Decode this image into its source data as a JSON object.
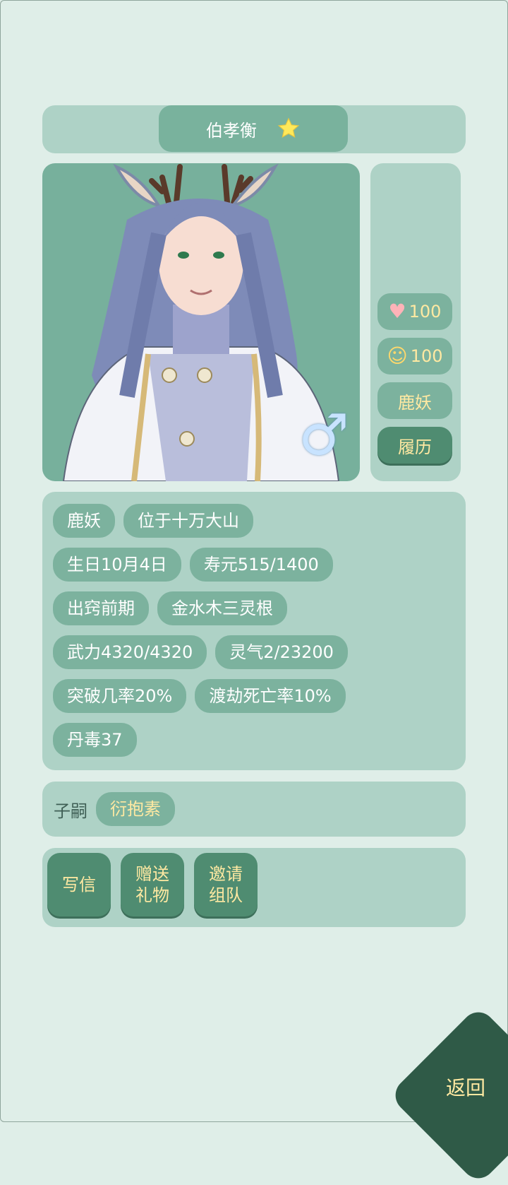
{
  "character": {
    "name": "伯孝衡",
    "gender_symbol": "♂"
  },
  "side": {
    "affection_value": "100",
    "mood_value": "100",
    "race_button": "鹿妖",
    "resume_button": "履历"
  },
  "info": {
    "tags": [
      "鹿妖",
      "位于十万大山",
      "生日10月4日",
      "寿元515/1400",
      "出窍前期",
      "金水木三灵根",
      "武力4320/4320",
      "灵气2/23200",
      "突破几率20%",
      "渡劫死亡率10%",
      "丹毒37"
    ]
  },
  "children": {
    "label": "子嗣",
    "child_name": "衍抱素"
  },
  "actions": {
    "write_letter": "写信",
    "send_gift": "赠送\n礼物",
    "invite_team": "邀请\n组队"
  },
  "nav": {
    "back_label": "返回"
  },
  "colors": {
    "background": "#dfeee8",
    "panel": "#aed2c6",
    "pill": "#7cb29e",
    "button_dark": "#4f8c71",
    "accent_text": "#ffe9a2",
    "back_button": "#2f5a47"
  }
}
